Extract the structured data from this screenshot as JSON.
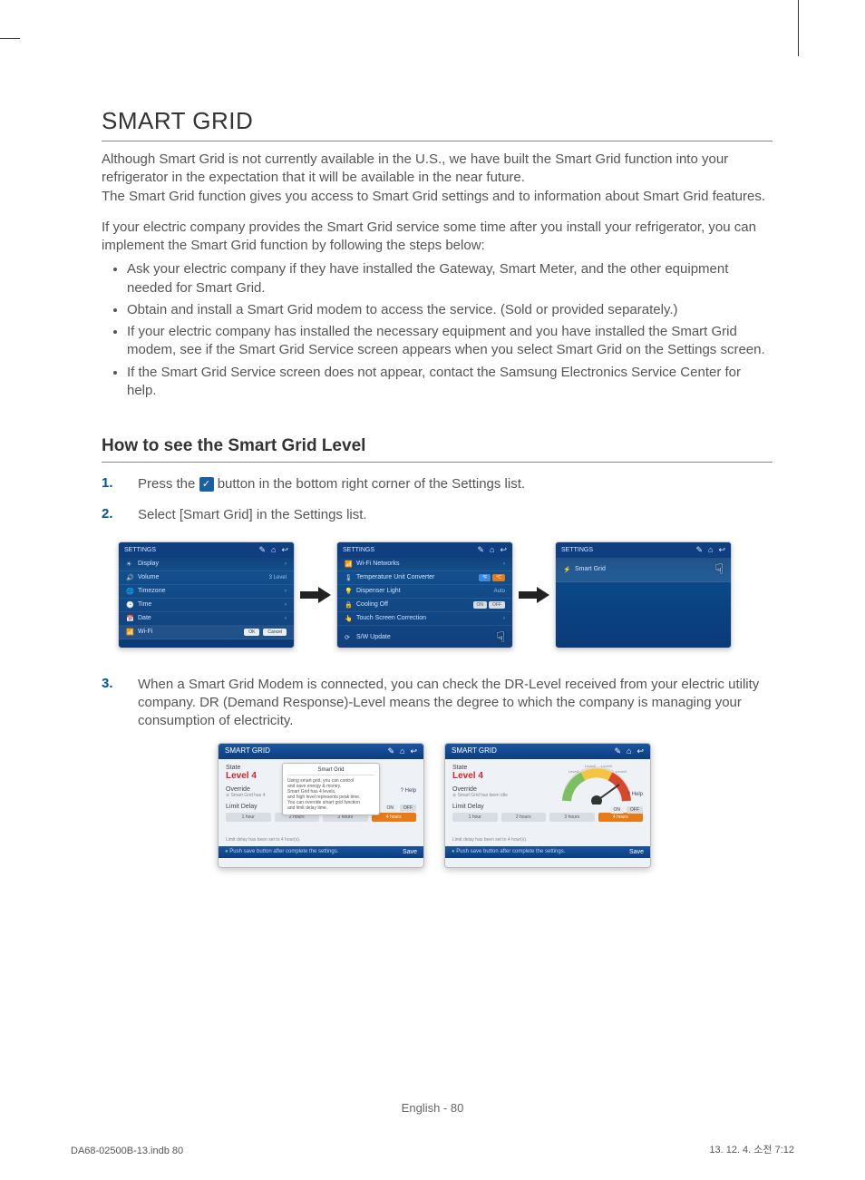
{
  "title": "SMART GRID",
  "intro_p1": "Although Smart Grid is not currently available in the U.S., we have built the Smart Grid function into your refrigerator in the expectation that it will be available in the near future.",
  "intro_p1b": "The Smart Grid function gives you access to Smart Grid settings and to information about Smart Grid features.",
  "intro_p2": "If your electric company provides the Smart Grid service some time after you install your refrigerator, you can implement the Smart Grid function by following the steps below:",
  "bullets": [
    "Ask your electric company if they have installed the Gateway, Smart Meter, and the other equipment needed for Smart Grid.",
    "Obtain and install a Smart Grid modem to access the service. (Sold or provided separately.)",
    "If your electric company has installed the necessary equipment and you have installed the Smart Grid modem, see if the Smart Grid Service screen appears when you select Smart Grid on the Settings screen.",
    "If the Smart Grid Service screen does not appear, contact the Samsung Electronics Service Center for help."
  ],
  "subheading": "How to see the Smart Grid Level",
  "steps": {
    "s1_num": "1.",
    "s1_pre": "Press the ",
    "s1_post": " button in the bottom right corner of the Settings list.",
    "s2_num": "2.",
    "s2_txt": "Select [Smart Grid] in the Settings list.",
    "s3_num": "3.",
    "s3_txt": "When a Smart Grid Modem is connected, you can check the DR-Level received from your electric utility company. DR (Demand Response)-Level means the degree to which the company is managing your consumption of electricity."
  },
  "settings_title": "SETTINGS",
  "screen1": {
    "rows": [
      {
        "icon": "display-icon",
        "label": "Display",
        "val": ""
      },
      {
        "icon": "volume-icon",
        "label": "Volume",
        "val": "3 Level"
      },
      {
        "icon": "timezone-icon",
        "label": "Timezone",
        "val": ""
      },
      {
        "icon": "time-icon",
        "label": "Time",
        "val": ""
      },
      {
        "icon": "date-icon",
        "label": "Date",
        "val": ""
      },
      {
        "icon": "wifi-icon",
        "label": "Wi-Fi",
        "val": ""
      }
    ],
    "ok": "OK",
    "cancel": "Cancel"
  },
  "screen2": {
    "rows": [
      {
        "icon": "wifi-icon",
        "label": "Wi-Fi Networks",
        "val": ""
      },
      {
        "icon": "temp-icon",
        "label": "Temperature Unit Converter",
        "pill_a": "°F",
        "pill_b": "°C"
      },
      {
        "icon": "light-icon",
        "label": "Dispenser Light",
        "val": "Auto"
      },
      {
        "icon": "lock-icon",
        "label": "Cooling Off",
        "pill_on": "ON",
        "pill_off": "OFF"
      },
      {
        "icon": "touch-icon",
        "label": "Touch Screen Correction",
        "val": ""
      },
      {
        "icon": "update-icon",
        "label": "S/W Update",
        "val": ""
      }
    ]
  },
  "screen3": {
    "row_label": "Smart Grid"
  },
  "dr": {
    "header": "SMART GRID",
    "state": "State",
    "level": "Level 4",
    "override": "Override",
    "override_sub1": "※ Smart Grid has been idle",
    "override_sub2": "※ Smart Grid has 4",
    "limit": "Limit Delay",
    "hours": [
      "1 hour",
      "2 hours",
      "3 hours",
      "4 hours"
    ],
    "set_out": "Limit delay has been set to 4 hour(s).",
    "bottom_hint": "Push save button after complete the settings.",
    "save": "Save",
    "help": "? Help",
    "on": "ON",
    "off": "OFF",
    "tooltip_title": "Smart Grid",
    "tooltip_l1": "Using smart grid, you can control",
    "tooltip_l2": "and save energy & money.",
    "tooltip_l3": "Smart Grid has 4 levels,",
    "tooltip_l4": "and high level represents peak time.",
    "tooltip_l5": "You can override smart grid function",
    "tooltip_l6": "and limit delay time.",
    "gauge_labels": [
      "Level1",
      "Level2",
      "Level3",
      "Level4"
    ]
  },
  "footer": {
    "center": "English - 80",
    "left": "DA68-02500B-13.indb   80",
    "right": "13. 12. 4.   소전 7:12"
  }
}
